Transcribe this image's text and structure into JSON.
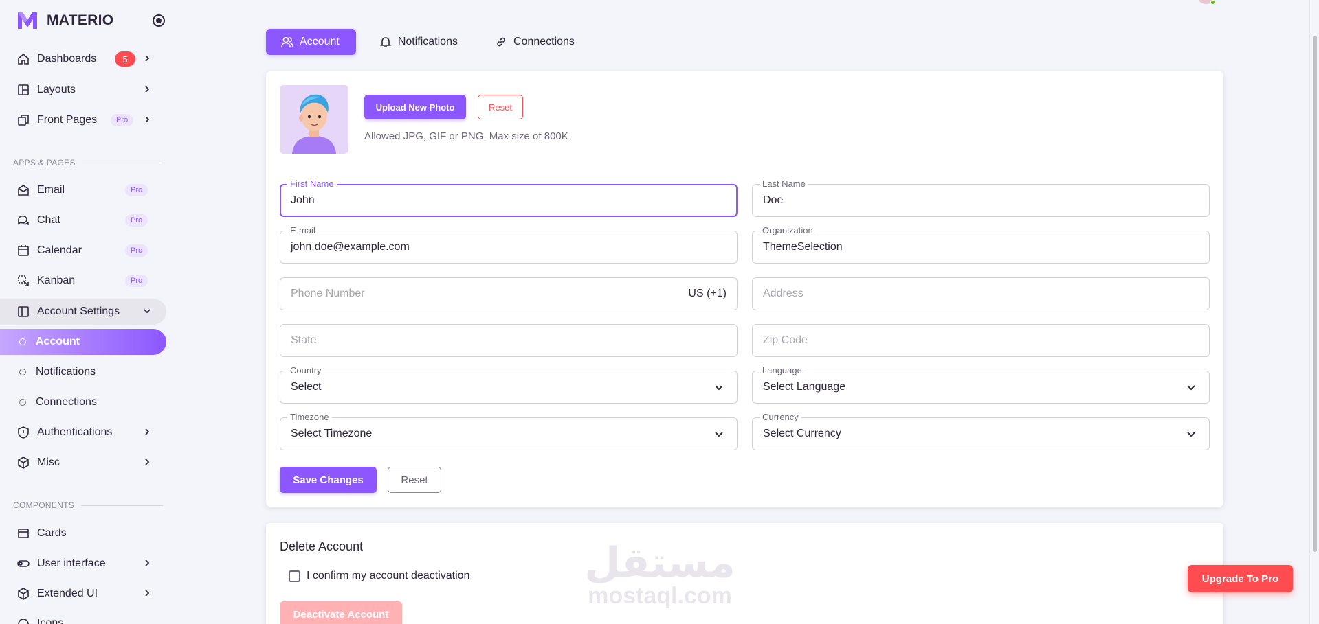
{
  "brand": {
    "name": "MATERIO"
  },
  "sidebar": {
    "items": [
      {
        "label": "Dashboards",
        "badge": "5"
      },
      {
        "label": "Layouts"
      },
      {
        "label": "Front Pages",
        "badge": "Pro"
      }
    ],
    "section_apps": "APPS & PAGES",
    "apps": [
      {
        "label": "Email",
        "badge": "Pro"
      },
      {
        "label": "Chat",
        "badge": "Pro"
      },
      {
        "label": "Calendar",
        "badge": "Pro"
      },
      {
        "label": "Kanban",
        "badge": "Pro"
      },
      {
        "label": "Account Settings"
      },
      {
        "label": "Account"
      },
      {
        "label": "Notifications"
      },
      {
        "label": "Connections"
      },
      {
        "label": "Authentications"
      },
      {
        "label": "Misc"
      }
    ],
    "section_components": "COMPONENTS",
    "components": [
      {
        "label": "Cards"
      },
      {
        "label": "User interface"
      },
      {
        "label": "Extended UI"
      },
      {
        "label": "Icons"
      }
    ]
  },
  "tabs": [
    {
      "label": "Account",
      "icon": "user-icon",
      "active": true
    },
    {
      "label": "Notifications",
      "icon": "bell-icon"
    },
    {
      "label": "Connections",
      "icon": "link-icon"
    }
  ],
  "profile": {
    "upload_label": "Upload New Photo",
    "reset_label": "Reset",
    "hint": "Allowed JPG, GIF or PNG. Max size of 800K"
  },
  "form": {
    "first_name": {
      "label": "First Name",
      "value": "John"
    },
    "last_name": {
      "label": "Last Name",
      "value": "Doe"
    },
    "email": {
      "label": "E-mail",
      "value": "john.doe@example.com"
    },
    "organization": {
      "label": "Organization",
      "value": "ThemeSelection"
    },
    "phone": {
      "placeholder": "Phone Number",
      "suffix": "US (+1)"
    },
    "address": {
      "placeholder": "Address"
    },
    "state": {
      "placeholder": "State"
    },
    "zip": {
      "placeholder": "Zip Code"
    },
    "country": {
      "label": "Country",
      "value": "Select"
    },
    "language": {
      "label": "Language",
      "value": "Select Language"
    },
    "timezone": {
      "label": "Timezone",
      "value": "Select Timezone"
    },
    "currency": {
      "label": "Currency",
      "value": "Select Currency"
    },
    "save_label": "Save Changes",
    "reset_label": "Reset"
  },
  "delete_account": {
    "title": "Delete Account",
    "confirm_label": "I confirm my account deactivation",
    "button_label": "Deactivate Account"
  },
  "watermark": {
    "arabic": "مستقل",
    "latin": "mostaql.com"
  },
  "upgrade_label": "Upgrade To Pro",
  "colors": {
    "primary": "#8c57ff",
    "danger": "#ff4c51",
    "background": "#f4f5fa",
    "text": "#2e263d"
  }
}
